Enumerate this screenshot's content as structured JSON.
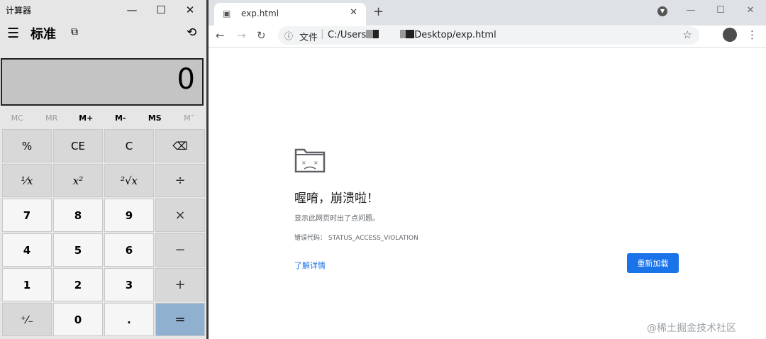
{
  "calculator": {
    "title": "计算器",
    "window_controls": {
      "minimize": "—",
      "maximize": "☐",
      "close": "✕"
    },
    "mode": "标准",
    "menu_icon": "hamburger-icon",
    "keep_on_top_icon": "keep-on-top-icon",
    "history_icon": "history-icon",
    "display": "0",
    "memory": [
      "MC",
      "MR",
      "M+",
      "M-",
      "MS",
      "M˅"
    ],
    "memory_disabled": [
      0,
      1,
      5
    ],
    "keys": [
      [
        "%",
        "CE",
        "C",
        "⌫"
      ],
      [
        "¹⁄x",
        "x²",
        "²√x",
        "÷"
      ],
      [
        "7",
        "8",
        "9",
        "×"
      ],
      [
        "4",
        "5",
        "6",
        "−"
      ],
      [
        "1",
        "2",
        "3",
        "+"
      ],
      [
        "⁺⁄₋",
        "0",
        ".",
        "="
      ]
    ]
  },
  "browser": {
    "tab_title": "exp.html",
    "new_tab": "+",
    "omnibox": {
      "scheme_label": "文件",
      "url_prefix": "C:/Users",
      "url_suffix": "Desktop/exp.html"
    },
    "error": {
      "heading": "喔唷，崩溃啦！",
      "description": "显示此网页时出了点问题。",
      "code": "错误代码：  STATUS_ACCESS_VIOLATION",
      "learn_more": "了解详情",
      "reload": "重新加载"
    }
  },
  "watermark": "@稀土掘金技术社区",
  "colors": {
    "accent": "#1a73e8",
    "equals_key": "#8fb0cf",
    "display_bg": "#c4c4c4"
  }
}
